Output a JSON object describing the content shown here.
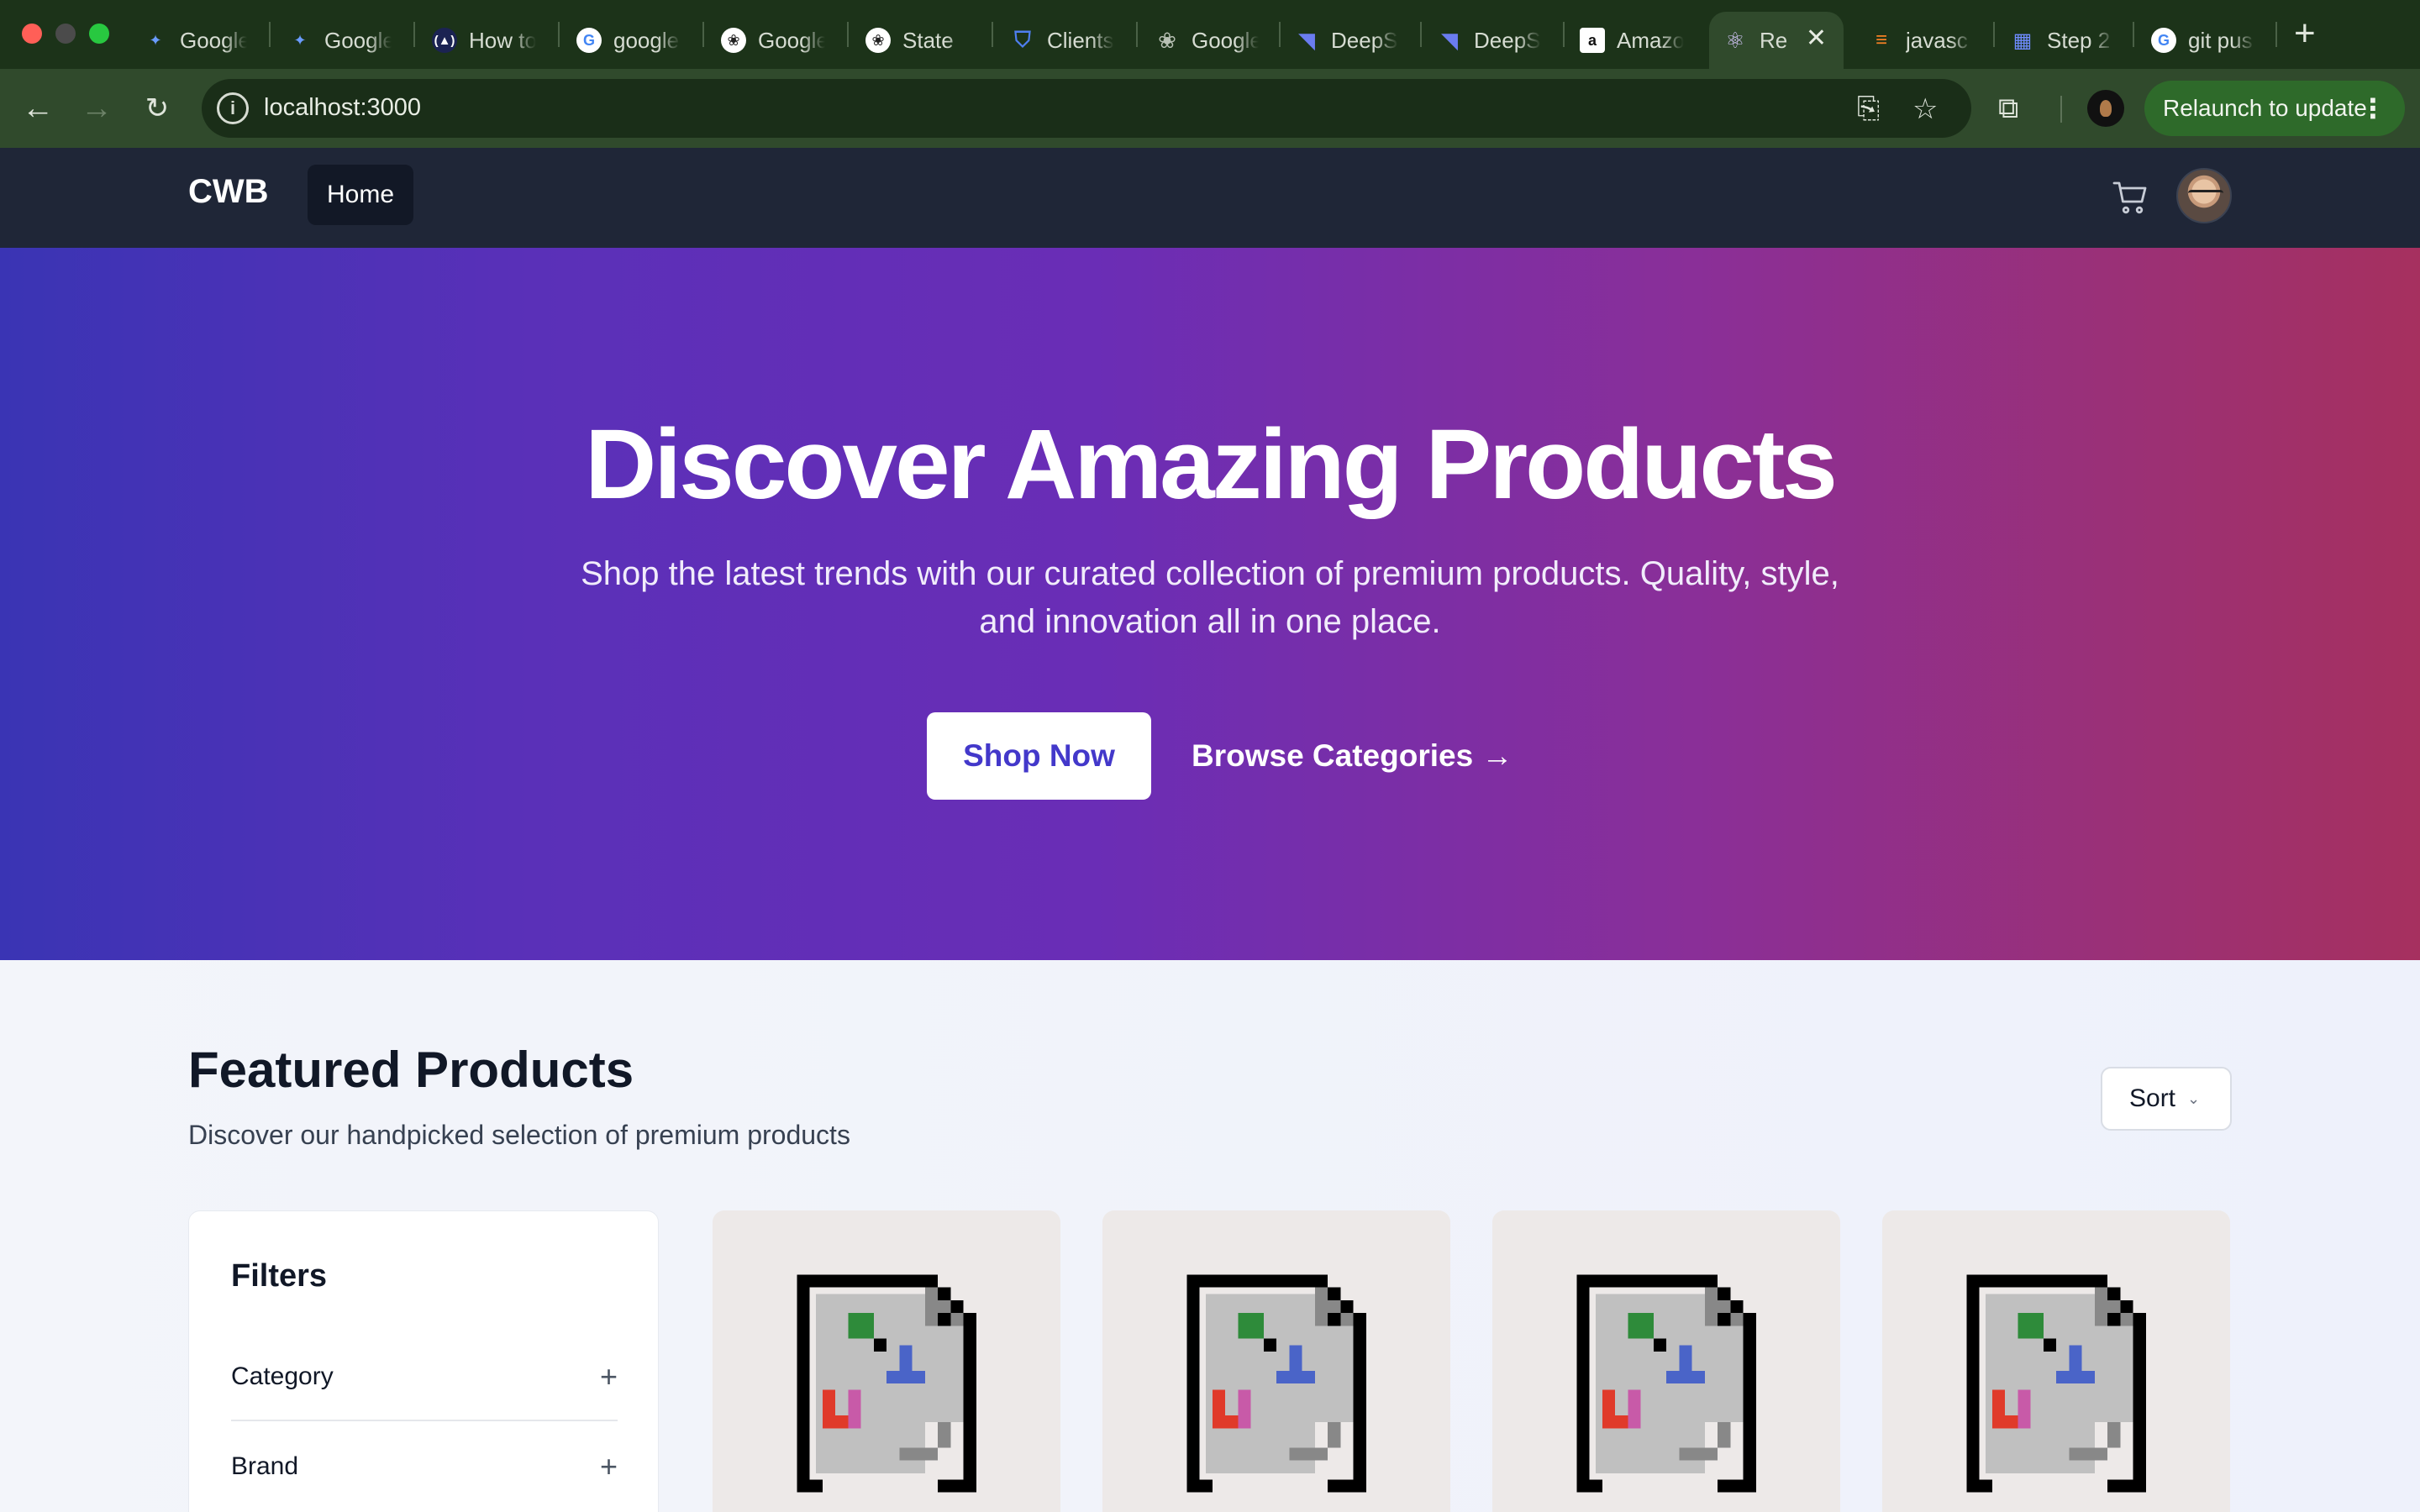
{
  "browser": {
    "tabs": [
      {
        "title": "Google",
        "icon": "gemini-icon"
      },
      {
        "title": "Google",
        "icon": "gemini-icon"
      },
      {
        "title": "How to",
        "icon": "vercel-icon"
      },
      {
        "title": "google",
        "icon": "google-icon"
      },
      {
        "title": "Google",
        "icon": "openai-icon"
      },
      {
        "title": "State",
        "icon": "openai-icon"
      },
      {
        "title": "Clients",
        "icon": "shield-icon"
      },
      {
        "title": "Google",
        "icon": "openai-icon"
      },
      {
        "title": "DeepS",
        "icon": "deepseek-icon"
      },
      {
        "title": "DeepS",
        "icon": "deepseek-icon"
      },
      {
        "title": "Amazo",
        "icon": "amazon-icon"
      },
      {
        "title": "Re",
        "icon": "react-icon",
        "active": true
      },
      {
        "title": "javasc",
        "icon": "stackoverflow-icon"
      },
      {
        "title": "Step 2",
        "icon": "gift-icon"
      },
      {
        "title": "git pus",
        "icon": "google-icon"
      }
    ],
    "url": "localhost:3000",
    "relaunch_label": "Relaunch to update"
  },
  "header": {
    "brand": "CWB",
    "nav": [
      {
        "label": "Home"
      }
    ]
  },
  "hero": {
    "title": "Discover Amazing Products",
    "subtitle": "Shop the latest trends with our curated collection of premium products. Quality, style, and innovation all in one place.",
    "primary_cta": "Shop Now",
    "secondary_cta": "Browse Categories →"
  },
  "featured": {
    "title": "Featured Products",
    "subtitle": "Discover our handpicked selection of premium products",
    "sort_label": "Sort",
    "filters": {
      "title": "Filters",
      "groups": [
        {
          "label": "Category"
        },
        {
          "label": "Brand"
        }
      ]
    },
    "product_count_visible": 4
  },
  "colors": {
    "chrome_bg": "#1c3319",
    "toolbar_bg": "#304a2c",
    "header_bg": "#1f2637",
    "hero_gradient_start": "#3a34b4",
    "hero_gradient_end": "#a6305f",
    "accent": "#4338ca"
  }
}
